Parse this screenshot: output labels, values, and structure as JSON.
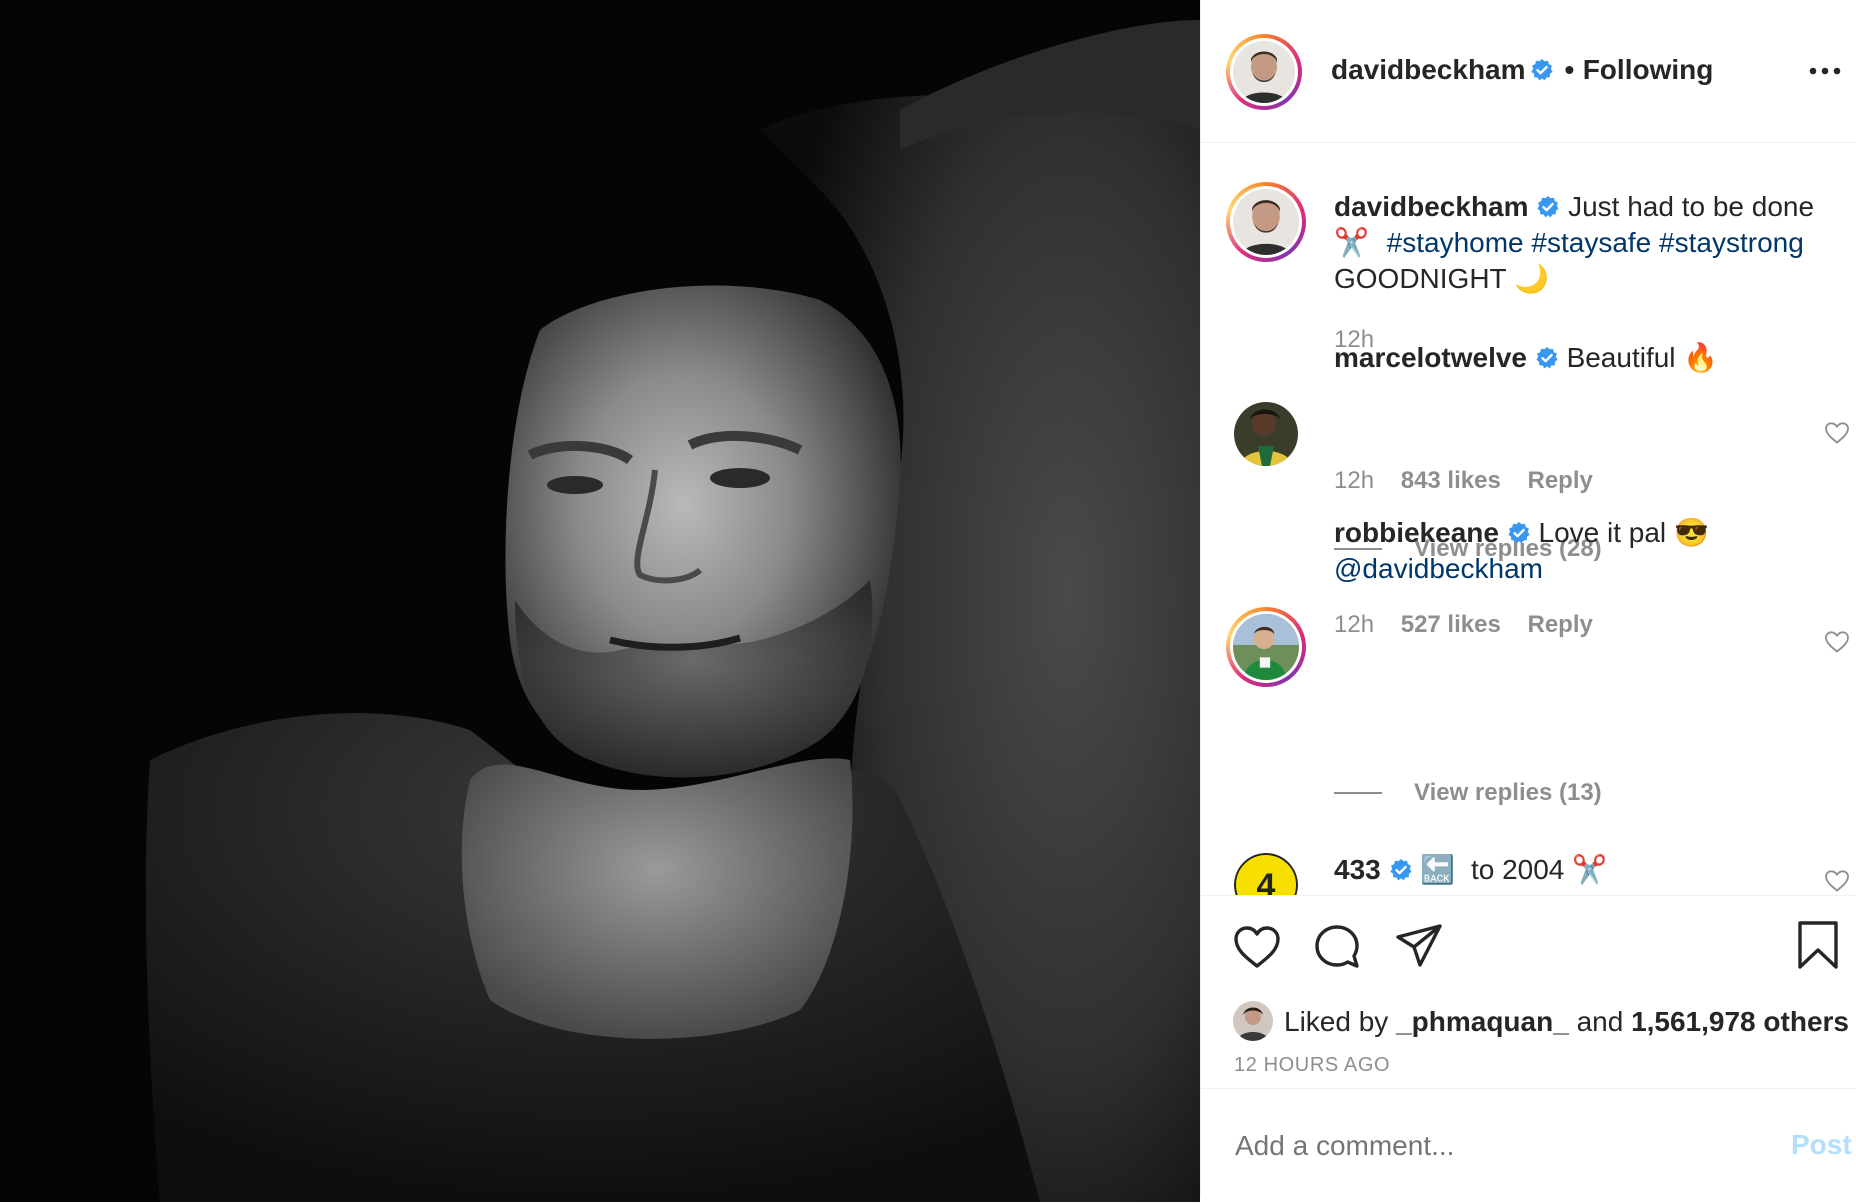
{
  "post": {
    "author": "davidbeckham",
    "follow_status": "Following",
    "more_icon": "more-horizontal-icon",
    "caption": {
      "username": "davidbeckham",
      "text_line1": "Just had to be done",
      "scissors_emoji": "✂️",
      "hashtags": [
        "#stayhome",
        "#staysafe",
        "#staystrong"
      ],
      "line3": "GOODNIGHT",
      "moon_emoji": "🌙",
      "time": "12h"
    },
    "comments": [
      {
        "username": "marcelotwelve",
        "text": "Beautiful",
        "emoji": "🔥",
        "time": "12h",
        "likes": "843 likes",
        "reply_label": "Reply",
        "view_replies": "View replies (28)"
      },
      {
        "username": "robbiekeane",
        "text": "Love it pal",
        "emoji": "😎",
        "mention": "@davidbeckham",
        "time": "12h",
        "likes": "527 likes",
        "reply_label": "Reply",
        "view_replies": "View replies (13)"
      },
      {
        "username": "433",
        "back_emoji": "🔙",
        "text": "to 2004",
        "scissors_emoji": "✂️"
      }
    ],
    "liked_by": {
      "prefix": "Liked by",
      "user": "_phmaquan_",
      "and": "and",
      "others": "1,561,978 others"
    },
    "timestamp": "12 HOURS AGO",
    "comment_input": {
      "placeholder": "Add a comment...",
      "post_label": "Post"
    },
    "colors": {
      "hashtag": "#00376b",
      "verified": "#3897f0",
      "post_button_disabled": "#b2dffc",
      "muted": "#8e8e8e"
    }
  }
}
